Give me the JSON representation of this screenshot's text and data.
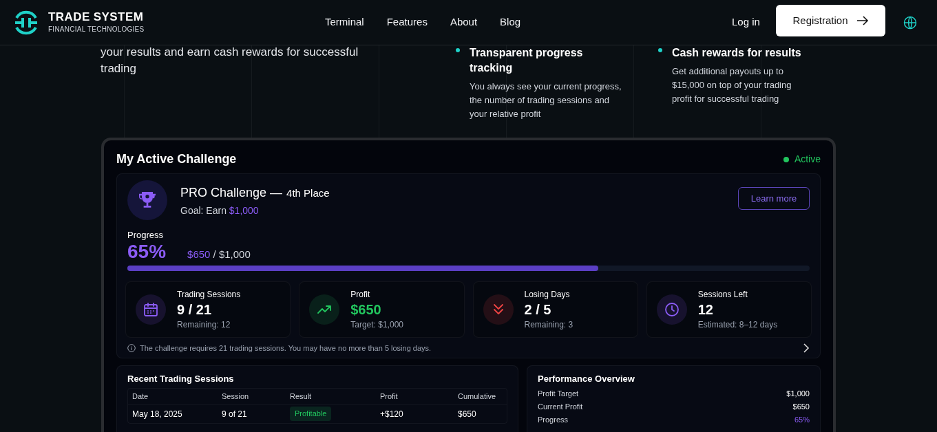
{
  "header": {
    "logo_title": "TRADE SYSTEM",
    "logo_subtitle": "FINANCIAL TECHNOLOGIES",
    "nav": [
      "Terminal",
      "Features",
      "About",
      "Blog"
    ],
    "login": "Log in",
    "register": "Registration"
  },
  "hero": {
    "text": "your results and earn cash rewards for successful trading",
    "features": [
      {
        "title": "Transparent progress tracking",
        "text": "You always see your current progress, the number of trading sessions and your relative profit"
      },
      {
        "title": "Cash rewards for results",
        "text": "Get additional payouts up to $15,000 on top of your trading profit for successful trading"
      }
    ]
  },
  "challenge": {
    "title": "My Active Challenge",
    "status": "Active",
    "name": "PRO Challenge —",
    "place": "4th Place",
    "goal": "Goal: Earn **$1,000**",
    "learn_more": "Learn more",
    "progress_label": "Progress",
    "percent": "65%",
    "amount": "$650",
    "amount_total": "/ $1,000",
    "level": 0.69,
    "stats": [
      {
        "kind": "calendar",
        "color": "#8b5cf6",
        "label": "Trading Sessions",
        "value": "9 / 21",
        "sub": "Remaining: 12"
      },
      {
        "kind": "trend",
        "color": "#22c55e",
        "label": "Profit",
        "value": "$650",
        "sub": "Target: $1,000"
      },
      {
        "kind": "chevrons",
        "color": "#ef4444",
        "label": "Losing Days",
        "value": "2 / 5",
        "sub": "Remaining: 3"
      },
      {
        "kind": "clock",
        "color": "#8b5cf6",
        "label": "Sessions Left",
        "value": "12",
        "sub": "Estimated: 8–12 days"
      }
    ],
    "note": "The challenge requires 21 trading sessions. You may have no more than 5 losing days."
  },
  "sessions": {
    "title": "Recent Trading Sessions",
    "columns": [
      "Date",
      "Session",
      "Result",
      "Profit",
      "Cumulative"
    ],
    "rows": [
      {
        "date": "May 18, 2025",
        "session": "9 of 21",
        "result": "Profitable",
        "color": "#22c55e",
        "profit": "+$120",
        "cumulative": "$650"
      }
    ]
  },
  "performance": {
    "title": "Performance Overview",
    "rows": [
      {
        "kind": "amount",
        "label": "Profit Target",
        "value": "$1,000"
      },
      {
        "kind": "amount",
        "label": "Current Profit",
        "value": "$650"
      },
      {
        "kind": "percent",
        "label": "Progress",
        "value": "65%"
      }
    ]
  }
}
